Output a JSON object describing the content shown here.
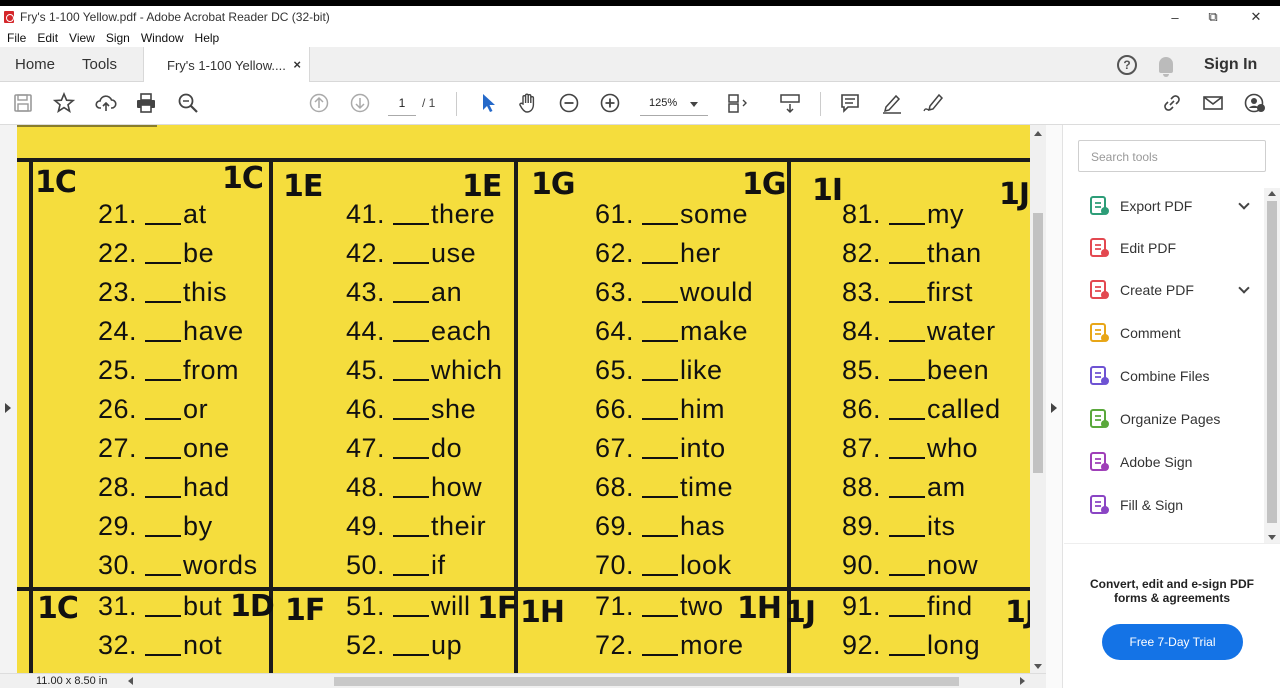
{
  "window": {
    "title": "Fry's 1-100  Yellow.pdf - Adobe Acrobat Reader DC (32-bit)",
    "minimize": "–",
    "restore": "⧉",
    "close": "✕"
  },
  "menu": [
    "File",
    "Edit",
    "View",
    "Sign",
    "Window",
    "Help"
  ],
  "tabs": {
    "home": "Home",
    "tools": "Tools",
    "document": "Fry's 1-100  Yellow....",
    "document_close": "×",
    "help": "?",
    "sign_in": "Sign In"
  },
  "toolbar": {
    "page_current": "1",
    "page_total": "/ 1",
    "zoom": "125%"
  },
  "document": {
    "section_marks": {
      "c_left": "1C",
      "c_right": "1C",
      "e_left": "1E",
      "e_right": "1E",
      "g_left": "1G",
      "g_right": "1G",
      "i_left": "1I",
      "i_right": "1J",
      "d_left": "1C",
      "d_right": "1D",
      "f_left": "1F",
      "f_right": "1F",
      "h_left": "1H",
      "h_right": "1H",
      "j_left": "1J",
      "j_right": "1J"
    },
    "columns": [
      {
        "words": [
          {
            "num": "21.",
            "word": "at"
          },
          {
            "num": "22.",
            "word": "be"
          },
          {
            "num": "23.",
            "word": "this"
          },
          {
            "num": "24.",
            "word": "have"
          },
          {
            "num": "25.",
            "word": "from"
          },
          {
            "num": "26.",
            "word": "or"
          },
          {
            "num": "27.",
            "word": "one"
          },
          {
            "num": "28.",
            "word": "had"
          },
          {
            "num": "29.",
            "word": "by"
          },
          {
            "num": "30.",
            "word": "words"
          },
          {
            "num": "31.",
            "word": "but"
          },
          {
            "num": "32.",
            "word": "not"
          }
        ]
      },
      {
        "words": [
          {
            "num": "41.",
            "word": "there"
          },
          {
            "num": "42.",
            "word": "use"
          },
          {
            "num": "43.",
            "word": "an"
          },
          {
            "num": "44.",
            "word": "each"
          },
          {
            "num": "45.",
            "word": "which"
          },
          {
            "num": "46.",
            "word": "she"
          },
          {
            "num": "47.",
            "word": "do"
          },
          {
            "num": "48.",
            "word": "how"
          },
          {
            "num": "49.",
            "word": "their"
          },
          {
            "num": "50.",
            "word": "if"
          },
          {
            "num": "51.",
            "word": "will"
          },
          {
            "num": "52.",
            "word": "up"
          }
        ]
      },
      {
        "words": [
          {
            "num": "61.",
            "word": "some"
          },
          {
            "num": "62.",
            "word": "her"
          },
          {
            "num": "63.",
            "word": "would"
          },
          {
            "num": "64.",
            "word": "make"
          },
          {
            "num": "65.",
            "word": "like"
          },
          {
            "num": "66.",
            "word": "him"
          },
          {
            "num": "67.",
            "word": "into"
          },
          {
            "num": "68.",
            "word": "time"
          },
          {
            "num": "69.",
            "word": "has"
          },
          {
            "num": "70.",
            "word": "look"
          },
          {
            "num": "71.",
            "word": "two"
          },
          {
            "num": "72.",
            "word": "more"
          }
        ]
      },
      {
        "words": [
          {
            "num": "81.",
            "word": "my"
          },
          {
            "num": "82.",
            "word": "than"
          },
          {
            "num": "83.",
            "word": "first"
          },
          {
            "num": "84.",
            "word": "water"
          },
          {
            "num": "85.",
            "word": "been"
          },
          {
            "num": "86.",
            "word": "called"
          },
          {
            "num": "87.",
            "word": "who"
          },
          {
            "num": "88.",
            "word": "am"
          },
          {
            "num": "89.",
            "word": "its"
          },
          {
            "num": "90.",
            "word": "now"
          },
          {
            "num": "91.",
            "word": "find"
          },
          {
            "num": "92.",
            "word": "long"
          }
        ]
      }
    ]
  },
  "status": {
    "page_size": "11.00 x 8.50 in"
  },
  "tools_panel": {
    "search_placeholder": "Search tools",
    "items": [
      {
        "label": "Export PDF",
        "icon": "export-pdf-icon",
        "color": "#2d9d78"
      },
      {
        "label": "Edit PDF",
        "icon": "edit-pdf-icon",
        "color": "#e34850"
      },
      {
        "label": "Create PDF",
        "icon": "create-pdf-icon",
        "color": "#e34850"
      },
      {
        "label": "Comment",
        "icon": "comment-icon",
        "color": "#e8a617"
      },
      {
        "label": "Combine Files",
        "icon": "combine-files-icon",
        "color": "#6e53d3"
      },
      {
        "label": "Organize Pages",
        "icon": "organize-pages-icon",
        "color": "#5aa83b"
      },
      {
        "label": "Adobe Sign",
        "icon": "adobe-sign-icon",
        "color": "#9f3fb8"
      },
      {
        "label": "Fill & Sign",
        "icon": "fill-sign-icon",
        "color": "#8a45c4"
      }
    ],
    "promo_text": "Convert, edit and e-sign PDF forms & agreements",
    "trial_button": "Free 7-Day Trial"
  }
}
